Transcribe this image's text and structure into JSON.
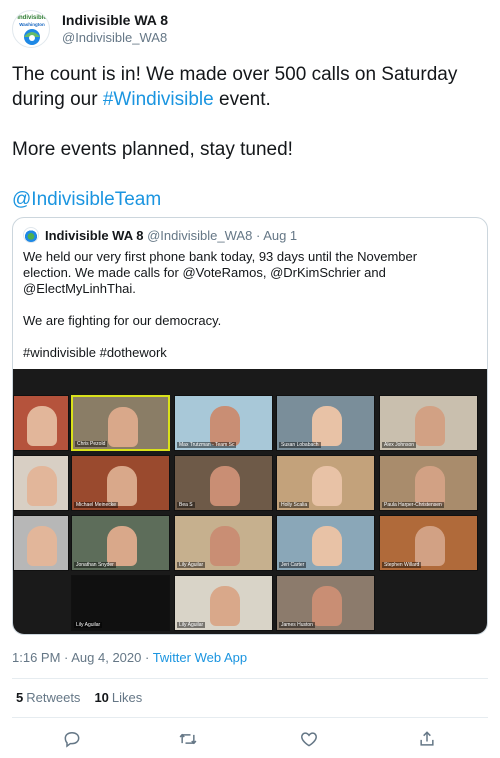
{
  "author": {
    "display_name": "Indivisible WA 8",
    "handle": "@Indivisible_WA8",
    "avatar_text": "Indivisible",
    "avatar_subtext": "Washington"
  },
  "tweet": {
    "lines": [
      [
        "The count is in! We made over 500 calls on Saturday"
      ],
      [
        "during our ",
        "#Windivisible",
        " event."
      ],
      [
        "More events planned, stay tuned!"
      ],
      [
        "@IndivisibleTeam"
      ]
    ],
    "line1": "The count is in! We made over 500 calls on Saturday",
    "line2_pre": "during our ",
    "hashtag": "#Windivisible",
    "line2_post": " event.",
    "line3": "More events planned, stay tuned!",
    "mention": "@IndivisibleTeam"
  },
  "quote": {
    "display_name": "Indivisible WA 8",
    "handle": "@Indivisible_WA8",
    "separator": "·",
    "date": "Aug 1",
    "line1": "We held our very first phone bank today, 93 days until the November",
    "line2": "election. We made calls for @VoteRamos, @DrKimSchrier and",
    "line3": "@ElectMyLinhThai.",
    "line4": "We are fighting for our democracy.",
    "line5": "#windivisible #dothework",
    "participants": [
      "",
      "Chris Pezold",
      "Max Trutzman - Team Sc",
      "Susan Lobabach",
      "Alex Johnson",
      "",
      "Michael Meinecke",
      "Bea S",
      "Holly Scalia",
      "Paula Harper-Christensen",
      "",
      "Jonathan Snyder",
      "Lily Aguilar",
      "Jeri Carter",
      "Stephen Willard",
      "Lily Aguilar",
      "Lily Aguilar",
      "James Huston"
    ]
  },
  "meta": {
    "time": "1:16 PM · Aug 4, 2020 · ",
    "app": "Twitter Web App"
  },
  "stats": {
    "retweets_count": "5",
    "retweets_label": "Retweets",
    "likes_count": "10",
    "likes_label": "Likes"
  },
  "icons": [
    "reply-icon",
    "retweet-icon",
    "like-icon",
    "share-icon"
  ],
  "colors": {
    "link": "#1b95e0",
    "text": "#14171a",
    "secondary": "#657786",
    "active_speaker": "#d9e11a"
  }
}
